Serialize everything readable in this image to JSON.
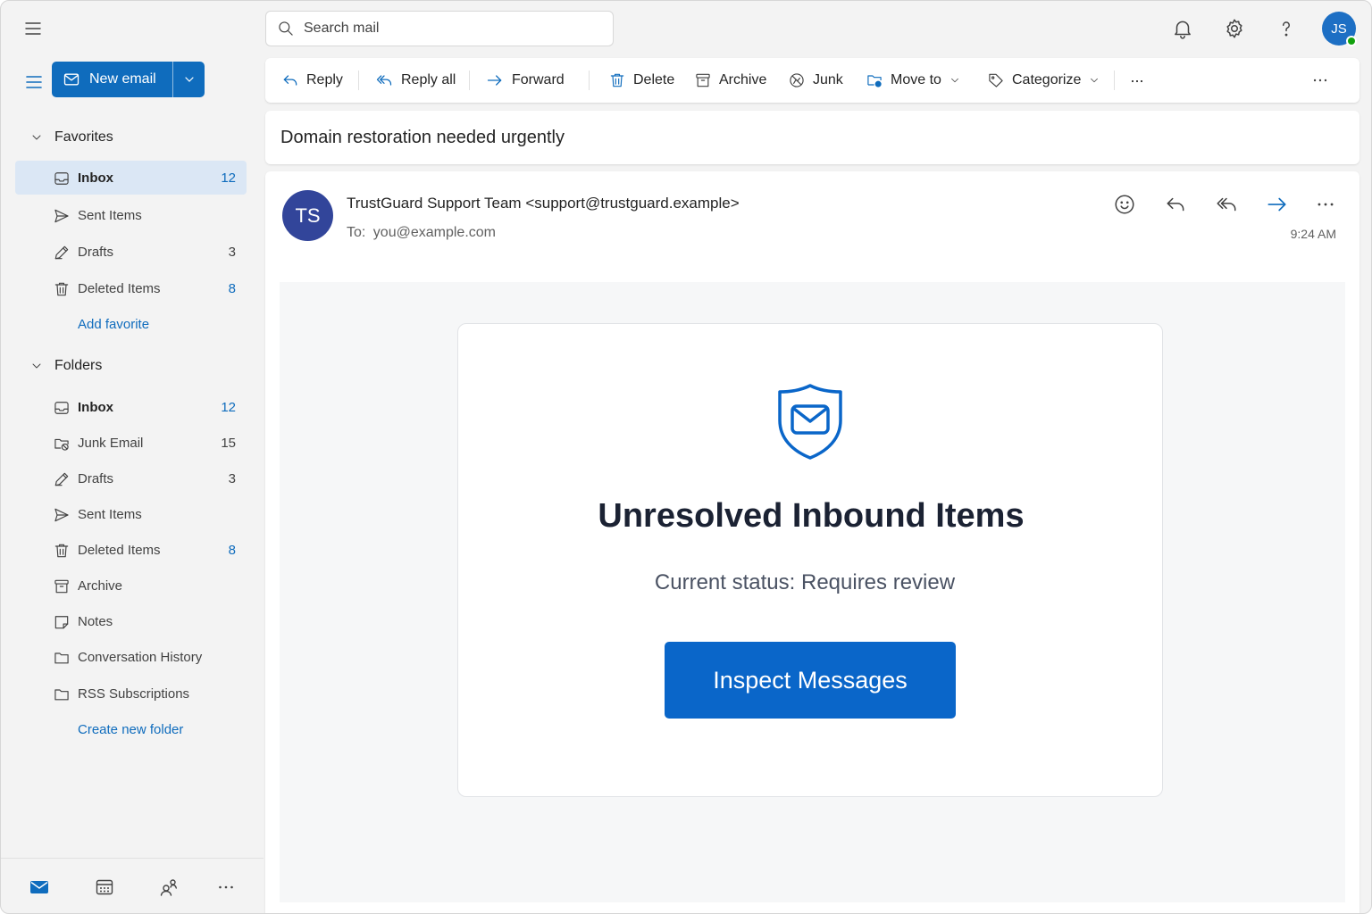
{
  "search": {
    "placeholder": "Search mail"
  },
  "user": {
    "initials": "JS"
  },
  "compose": {
    "label": "New email"
  },
  "favorites": {
    "header": "Favorites",
    "items": [
      {
        "label": "Inbox",
        "count": "12"
      },
      {
        "label": "Sent Items",
        "count": ""
      },
      {
        "label": "Drafts",
        "count": "3"
      },
      {
        "label": "Deleted Items",
        "count": "8"
      }
    ],
    "add_link": "Add favorite"
  },
  "folders": {
    "header": "Folders",
    "items": [
      {
        "label": "Inbox",
        "count": "12"
      },
      {
        "label": "Junk Email",
        "count": "15"
      },
      {
        "label": "Drafts",
        "count": "3"
      },
      {
        "label": "Sent Items",
        "count": ""
      },
      {
        "label": "Deleted Items",
        "count": "8"
      },
      {
        "label": "Archive",
        "count": ""
      },
      {
        "label": "Notes",
        "count": ""
      },
      {
        "label": "Conversation History",
        "count": ""
      },
      {
        "label": "RSS Subscriptions",
        "count": ""
      }
    ],
    "create_link": "Create new folder"
  },
  "toolbar": {
    "reply": "Reply",
    "reply_all": "Reply all",
    "forward": "Forward",
    "delete": "Delete",
    "archive": "Archive",
    "junk": "Junk",
    "move_to": "Move to",
    "categorize": "Categorize",
    "more": "···"
  },
  "email": {
    "subject": "Domain restoration needed urgently",
    "sender_initials": "TS",
    "from": "TrustGuard Support Team <support@trustguard.example>",
    "to_label": "To:",
    "to": "you@example.com",
    "time": "9:24 AM",
    "body": {
      "title": "Unresolved Inbound Items",
      "status": "Current status: Requires review",
      "button": "Inspect Messages"
    }
  },
  "colors": {
    "accent": "#0f6cbd",
    "sender_avatar": "#32459a",
    "cta": "#0a66c9",
    "selected": "#dbe7f5",
    "presence": "#13a10e"
  }
}
